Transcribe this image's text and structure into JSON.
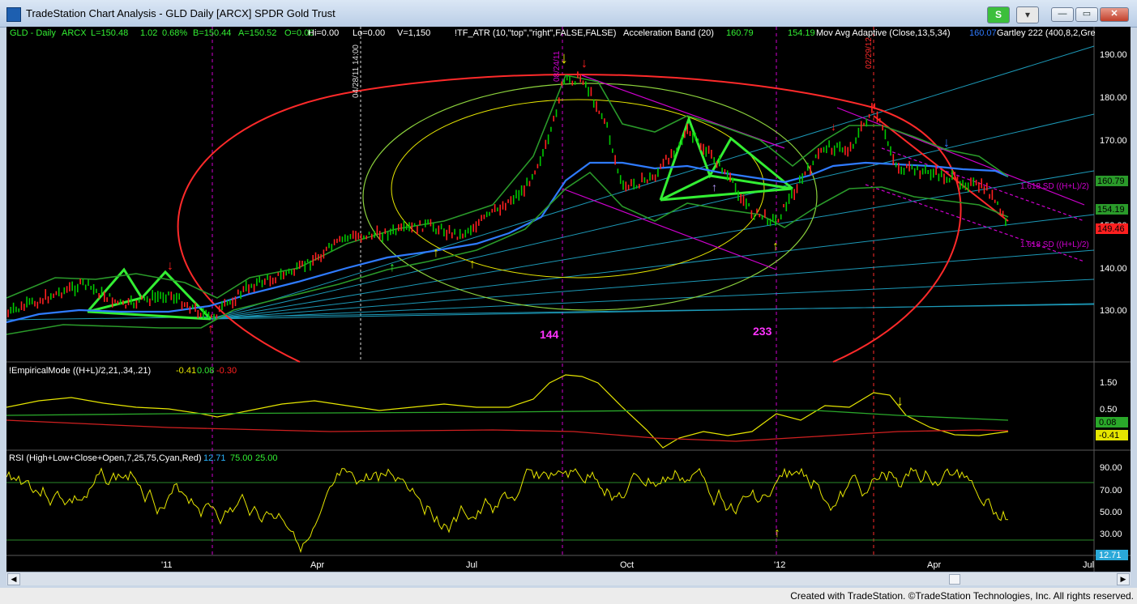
{
  "window": {
    "title": "TradeStation Chart Analysis - GLD Daily [ARCX] SPDR Gold Trust",
    "s_button": "S",
    "minimize": "–",
    "maximize": "□",
    "close": "✕",
    "small_min": "—",
    "small_max": "▭",
    "small_close": "✕"
  },
  "header": {
    "symbol": "GLD - Daily",
    "exchange": "ARCX",
    "last": "L=150.48",
    "chg": "1.02",
    "pct": "0.68%",
    "bid": "B=150.44",
    "ask": "A=150.52",
    "o": "O=0.00",
    "hi": "Hi=0.00",
    "lo": "Lo=0.00",
    "vol": "V=1,150",
    "tf_atr": "!TF_ATR (10,\"top\",\"right\",FALSE,FALSE)",
    "acc_band": "Acceleration Band (20)",
    "acc_val1": "160.79",
    "acc_val2": "154.19",
    "mov_avg": "Mov Avg Adaptive (Close,13,5,34)",
    "mov_val": "160.07",
    "gartley": "Gartley 222 (400,8,2,Gre"
  },
  "price_axis": [
    "190.00",
    "180.00",
    "170.00",
    "160.00",
    "150.00",
    "140.00",
    "130.00"
  ],
  "price_tags": {
    "upper": "160.79",
    "mid": "154.19",
    "last": "149.46"
  },
  "annotations": {
    "date1": "04/28/11 14:00",
    "date2": "08/24/11",
    "date3": "02/29/12",
    "fib1": "144",
    "fib2": "233",
    "sd_upper": "1.618 SD ((H+L)/2)",
    "sd_lower": "1.618 SD ((H+L)/2)"
  },
  "empirical": {
    "label": "!EmpiricalMode ((H+L)/2,21,.34,.21)",
    "v1": "-0.41",
    "v2": "0.08",
    "v3": "-0.30",
    "axis": [
      "1.50",
      "0.50"
    ],
    "tag_green": "0.08",
    "tag_yellow": "-0.41"
  },
  "rsi": {
    "label": "RSI (High+Low+Close+Open,7,25,75,Cyan,Red)",
    "v1": "12.71",
    "v2": "75.00",
    "v3": "25.00",
    "axis": [
      "90.00",
      "70.00",
      "50.00",
      "30.00"
    ],
    "tag": "12.71"
  },
  "time_axis": [
    "'11",
    "Apr",
    "Jul",
    "Oct",
    "'12",
    "Apr",
    "Jul"
  ],
  "footer": "Created with TradeStation. ©TradeStation Technologies, Inc. All rights reserved.",
  "colors": {
    "background": "#000000",
    "up": "#00c800",
    "down": "#ff2020",
    "gartley": "#33ee33",
    "ellipse": "#ff2a2a",
    "ma": "#2f7bff"
  }
}
